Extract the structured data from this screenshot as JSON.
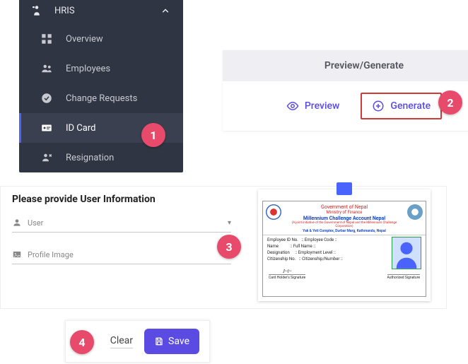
{
  "sidebar": {
    "section": "HRIS",
    "items": [
      {
        "label": "Overview"
      },
      {
        "label": "Employees"
      },
      {
        "label": "Change Requests"
      },
      {
        "label": "ID Card"
      },
      {
        "label": "Resignation"
      }
    ]
  },
  "steps": {
    "s1": "1",
    "s2": "2",
    "s3": "3",
    "s4": "4"
  },
  "preview_generate": {
    "title": "Preview/Generate",
    "preview": "Preview",
    "generate": "Generate"
  },
  "userinfo": {
    "title": "Please provide User Information",
    "user_label": "User",
    "profile_image_label": "Profile Image"
  },
  "idcard": {
    "gov": "Government of Nepal",
    "ministry": "Ministry of Finance",
    "org": "Millennium Challenge Account Nepal",
    "sub": "(A joint initiative of the Government of Nepal and the Millennium Challenge Corporation)",
    "addr": "Yak & Yeti Complex, Durbar Marg, Kathmandu, Nepal",
    "f_empid": "Employee ID No.",
    "v_empid": ":: Employee Code ::",
    "f_name": "Name",
    "v_name": ":: Full Name ::",
    "f_desig": "Designation",
    "v_desig": ":: Employment Level ::",
    "f_citizen": "Citizenship No.",
    "v_citizen": ":: Citizenship/Number ::",
    "sig_holder": "Card Holder's Signature",
    "sig_auth": "Authorized Signature"
  },
  "actions": {
    "clear": "Clear",
    "save": "Save"
  }
}
